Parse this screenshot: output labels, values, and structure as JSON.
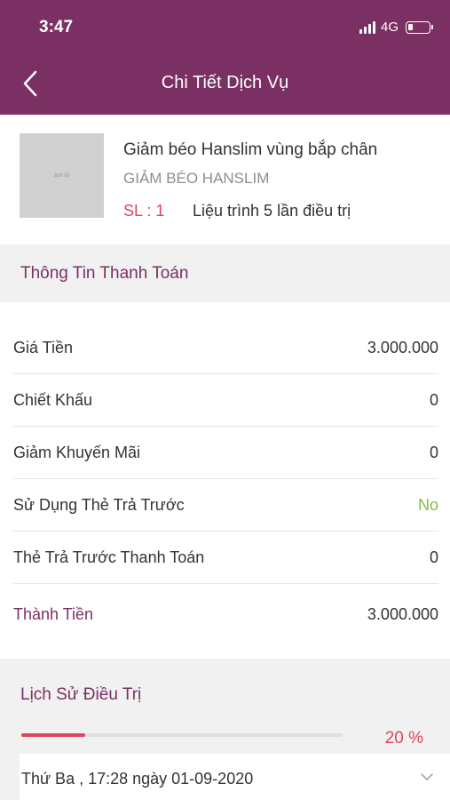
{
  "status_bar": {
    "time": "3:47",
    "network": "4G"
  },
  "header": {
    "title": "Chi Tiết Dịch Vụ"
  },
  "product": {
    "thumb_text": "ảnh lỗi",
    "name": "Giảm béo Hanslim vùng bắp chân",
    "brand": "GIẢM BÉO HANSLIM",
    "quantity": "SL : 1",
    "course": "Liệu trình 5 lần điều trị"
  },
  "payment": {
    "section_title": "Thông Tin Thanh Toán",
    "rows": [
      {
        "label": "Giá Tiền",
        "value": "3.000.000"
      },
      {
        "label": "Chiết Khấu",
        "value": "0"
      },
      {
        "label": "Giảm Khuyến Mãi",
        "value": "0"
      },
      {
        "label": "Sử Dụng Thẻ Trả Trước",
        "value": "No"
      },
      {
        "label": "Thẻ Trả Trước Thanh Toán",
        "value": "0"
      },
      {
        "label": "Thành Tiền",
        "value": "3.000.000"
      }
    ]
  },
  "history": {
    "section_title": "Lịch Sử Điều Trị",
    "progress_percent": 20,
    "progress_text": "20 %",
    "entries": [
      {
        "date": "Thứ Ba , 17:28 ngày 01-09-2020"
      }
    ]
  },
  "colors": {
    "brand": "#7a3063",
    "accent_red": "#e0455a",
    "accent_green": "#7ac143"
  },
  "icons": [
    "back-arrow-icon",
    "signal-icon",
    "battery-icon",
    "chevron-down-icon"
  ]
}
